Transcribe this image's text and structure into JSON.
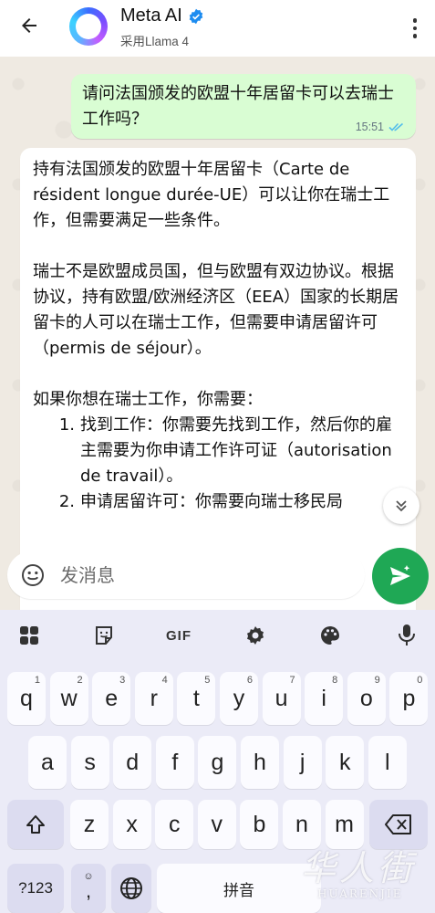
{
  "header": {
    "title": "Meta AI",
    "subtitle": "采用Llama 4"
  },
  "chat": {
    "outgoing": {
      "text": "请问法国颁发的欧盟十年居留卡可以去瑞士工作吗？",
      "time": "15:51",
      "status": "read"
    },
    "incoming": {
      "para1": "持有法国颁发的欧盟十年居留卡（Carte de résident longue durée-UE）可以让你在瑞士工作，但需要满足一些条件。",
      "para2": "瑞士不是欧盟成员国，但与欧盟有双边协议。根据协议，持有欧盟/欧洲经济区（EEA）国家的长期居留卡的人可以在瑞士工作，但需要申请居留许可（permis de séjour）。",
      "para3": "如果你想在瑞士工作，你需要：",
      "list": [
        {
          "num": "1.",
          "text": "找到工作：你需要先找到工作，然后你的雇主需要为你申请工作许可证（autorisation de travail）。"
        },
        {
          "num": "2.",
          "text": "申请居留许可：你需要向瑞士移民局"
        }
      ]
    }
  },
  "input": {
    "placeholder": "发消息"
  },
  "keyboard": {
    "toolbar": {
      "gif": "GIF"
    },
    "row1": [
      {
        "k": "q",
        "h": "1"
      },
      {
        "k": "w",
        "h": "2"
      },
      {
        "k": "e",
        "h": "3"
      },
      {
        "k": "r",
        "h": "4"
      },
      {
        "k": "t",
        "h": "5"
      },
      {
        "k": "y",
        "h": "6"
      },
      {
        "k": "u",
        "h": "7"
      },
      {
        "k": "i",
        "h": "8"
      },
      {
        "k": "o",
        "h": "9"
      },
      {
        "k": "p",
        "h": "0"
      }
    ],
    "row2": [
      "a",
      "s",
      "d",
      "f",
      "g",
      "h",
      "j",
      "k",
      "l"
    ],
    "row3": [
      "z",
      "x",
      "c",
      "v",
      "b",
      "n",
      "m"
    ],
    "bottom": {
      "mode": "?123",
      "emoji_hint": "☺",
      "comma": ",",
      "space": "拼音"
    }
  },
  "watermark": {
    "script": "华人街",
    "latin": "HUARENJIE"
  }
}
